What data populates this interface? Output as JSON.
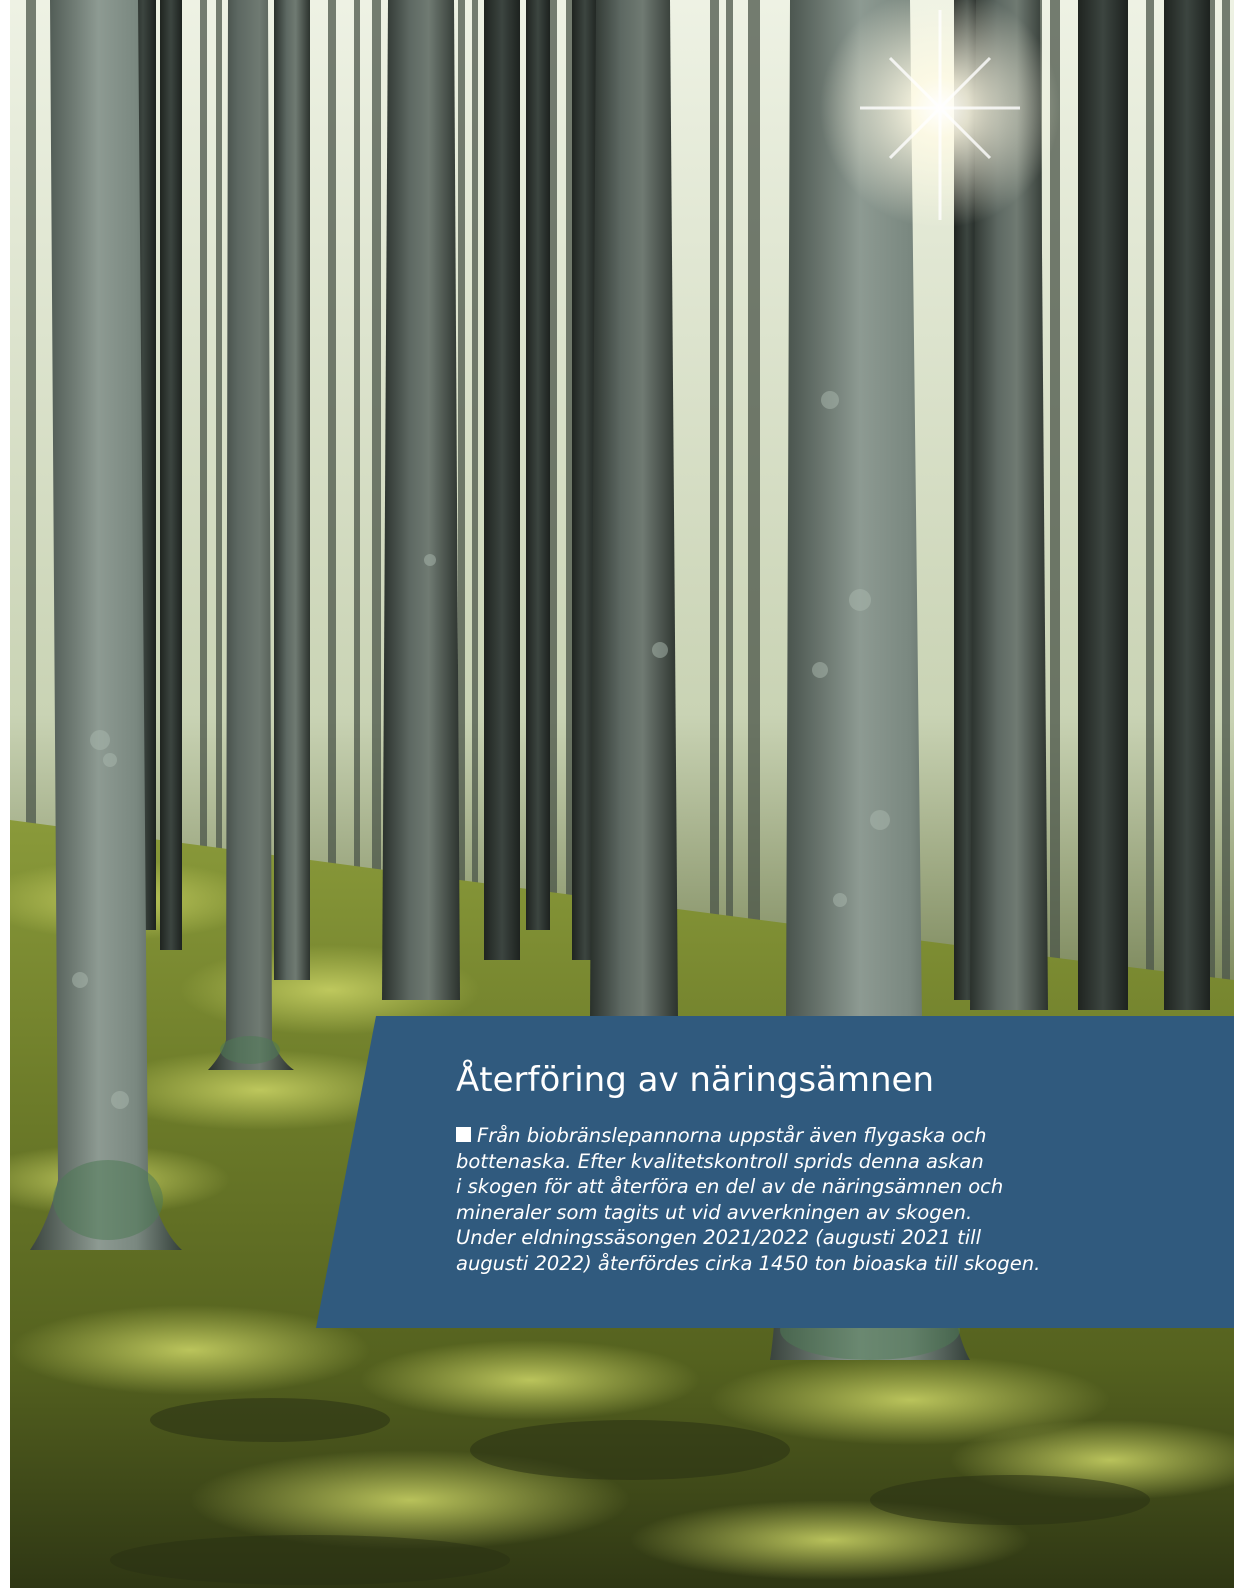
{
  "article": {
    "title": "Återföring av näringsämnen",
    "body_lines": [
      "Från biobränslepannorna uppstår även flygaska och",
      "bottenaska. Efter kvalitetskontroll sprids denna askan",
      "i skogen för att återföra en del av de näringsämnen och",
      "mineraler som tagits ut vid avverkningen av skogen.",
      "Under eldningssäsongen 2021/2022 (augusti 2021 till",
      "augusti 2022) återfördes cirka 1450 ton bioaska till skogen."
    ],
    "bullet_icon": "square-bullet-icon"
  },
  "colors": {
    "panel": "#305a7e",
    "text": "#ffffff",
    "moss": "#7a8a2a",
    "sky": "#e6ecda",
    "bark": "#4f5a55"
  }
}
